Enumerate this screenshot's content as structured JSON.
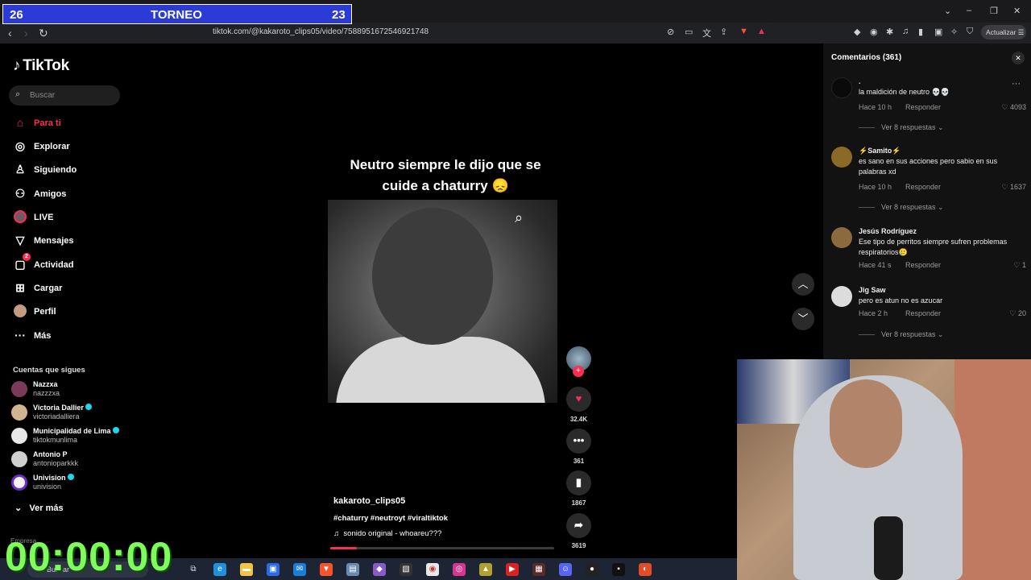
{
  "overlay": {
    "score_left": "26",
    "title": "TORNEO",
    "score_right": "23",
    "timer": "00:00:00"
  },
  "browser": {
    "url": "tiktok.com/@kakaroto_clips05/video/7588951672546921748",
    "update_label": "Actualizar"
  },
  "sidebar": {
    "logo": "TikTok",
    "search_placeholder": "Buscar",
    "nav": [
      {
        "label": "Para ti",
        "icon": "home-icon"
      },
      {
        "label": "Explorar",
        "icon": "compass-icon"
      },
      {
        "label": "Siguiendo",
        "icon": "following-icon"
      },
      {
        "label": "Amigos",
        "icon": "friends-icon"
      },
      {
        "label": "LIVE",
        "icon": "live-icon"
      },
      {
        "label": "Mensajes",
        "icon": "messages-icon"
      },
      {
        "label": "Actividad",
        "icon": "activity-icon",
        "badge": "2"
      },
      {
        "label": "Cargar",
        "icon": "upload-icon"
      },
      {
        "label": "Perfil",
        "icon": "profile-icon"
      },
      {
        "label": "Más",
        "icon": "more-icon"
      }
    ],
    "following_title": "Cuentas que sigues",
    "accounts": [
      {
        "name": "Nazzxa",
        "user": "nazzzxa"
      },
      {
        "name": "Victoria Dallier",
        "user": "victoriadalliera"
      },
      {
        "name": "Municipalidad de Lima",
        "user": "tiktokmunlima"
      },
      {
        "name": "Antonio P",
        "user": "antonioparkkk"
      },
      {
        "name": "Univision",
        "user": "univision"
      }
    ],
    "see_more": "Ver más",
    "footer": "Empresa"
  },
  "video": {
    "caption": "Neutro siempre le dijo que se cuide a chaturry 😞",
    "username": "kakaroto_clips05",
    "hashtags": "#chaturry #neutroyt #viraltiktok",
    "sound": "sonido original - whoareu???",
    "progress": 0.12,
    "likes": "32.4K",
    "comments": "361",
    "saves": "1867",
    "shares": "3619"
  },
  "comments": {
    "header": "Comentarios (361)",
    "items": [
      {
        "name": ".",
        "text": "la maldición de neutro 💀💀",
        "time": "Hace 10 h",
        "reply": "Responder",
        "likes": "4093",
        "more": "Ver 8 respuestas"
      },
      {
        "name": "⚡Samito⚡",
        "text": "es sano en sus acciones pero sabio en sus palabras xd",
        "time": "Hace 10 h",
        "reply": "Responder",
        "likes": "1637",
        "more": "Ver 8 respuestas"
      },
      {
        "name": "Jesús Rodríguez",
        "text": "Ese tipo de perritos siempre sufren problemas respiratorios🥲",
        "time": "Hace 41 s",
        "reply": "Responder",
        "likes": "1",
        "more": ""
      },
      {
        "name": "Jig Saw",
        "text": "pero es atun no es azucar",
        "time": "Hace 2 h",
        "reply": "Responder",
        "likes": "20",
        "more": "Ver 8 respuestas"
      }
    ]
  },
  "taskbar": {
    "search": "Buscar"
  },
  "colors": {
    "accent": "#fe2c55",
    "torneo": "#2c3ad6",
    "timer": "#7dfc5a"
  }
}
